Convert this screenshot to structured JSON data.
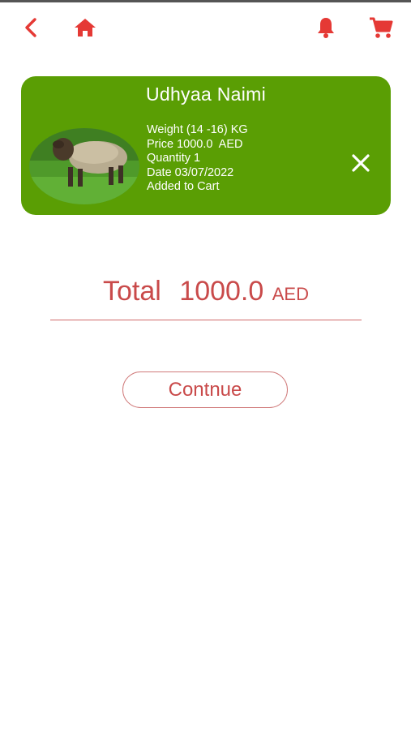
{
  "nav": {
    "back_icon": "chevron-left-icon",
    "home_icon": "home-icon",
    "bell_icon": "bell-icon",
    "cart_icon": "cart-icon",
    "accent_color": "#e53935"
  },
  "cart_item": {
    "name": "Udhyaa Naimi",
    "weight": "Weight (14 -16) KG",
    "price": "Price 1000.0  AED",
    "quantity": "Quantity 1",
    "date": "Date 03/07/2022",
    "status": "Added to Cart",
    "remove_icon": "close-icon",
    "card_color": "#5a9e04"
  },
  "total": {
    "label": "Total",
    "amount": "1000.0",
    "currency": "AED",
    "color": "#c94a4a"
  },
  "actions": {
    "continue_label": "Contnue"
  }
}
